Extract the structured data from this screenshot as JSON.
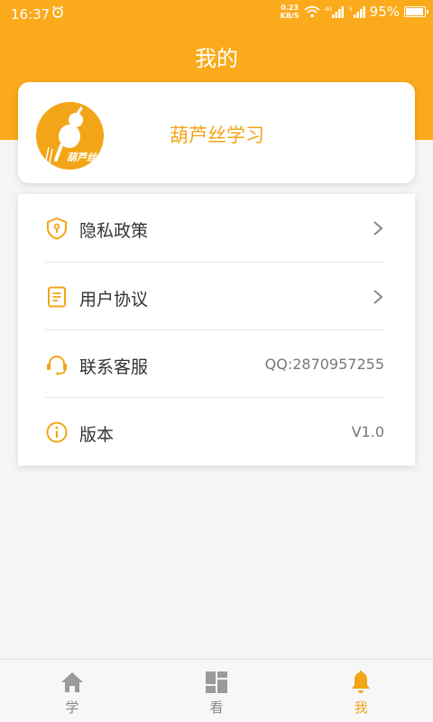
{
  "status_bar": {
    "time": "16:37",
    "net_speed_value": "0.23",
    "net_speed_unit": "KB/S",
    "signal_1_label": "4G",
    "signal_2_label": "5",
    "battery": "95%"
  },
  "header": {
    "title": "我的"
  },
  "profile": {
    "name": "葫芦丝学习",
    "avatar_text": "葫芦丝"
  },
  "menu": {
    "items": [
      {
        "label": "隐私政策",
        "icon": "shield-icon",
        "has_chevron": true
      },
      {
        "label": "用户协议",
        "icon": "document-icon",
        "has_chevron": true
      },
      {
        "label": "联系客服",
        "icon": "headset-icon",
        "value": "QQ:2870957255"
      },
      {
        "label": "版本",
        "icon": "info-icon",
        "value": "V1.0"
      }
    ]
  },
  "tabbar": {
    "tabs": [
      {
        "label": "学",
        "icon": "home-icon",
        "active": false
      },
      {
        "label": "看",
        "icon": "grid-icon",
        "active": false
      },
      {
        "label": "我",
        "icon": "bell-icon",
        "active": true
      }
    ]
  },
  "colors": {
    "accent": "#fbaa1b",
    "accent_text": "#f2a516",
    "background": "#f5f5f5"
  }
}
